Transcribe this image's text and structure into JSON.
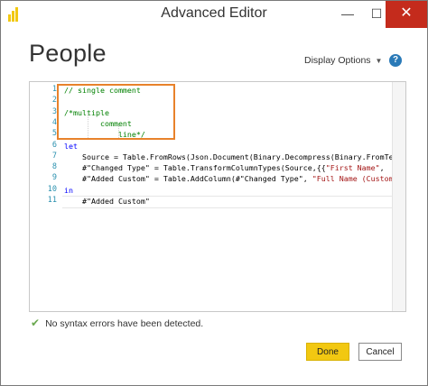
{
  "window": {
    "title": "Advanced Editor",
    "minimize_glyph": "—",
    "maximize_glyph": "☐",
    "close_glyph": "✕"
  },
  "header": {
    "page_title": "People",
    "display_options_label": "Display Options",
    "display_options_caret": "▼",
    "help_glyph": "?"
  },
  "editor": {
    "line_numbers": [
      "1",
      "2",
      "3",
      "4",
      "5",
      "6",
      "7",
      "8",
      "9",
      "10",
      "11"
    ],
    "lines": [
      [
        {
          "t": "// single comment",
          "c": "c-comment"
        }
      ],
      [],
      [
        {
          "t": "/*multiple",
          "c": "c-comment"
        }
      ],
      [
        {
          "t": "        comment",
          "c": "c-comment"
        }
      ],
      [
        {
          "t": "            line*/",
          "c": "c-comment"
        }
      ],
      [
        {
          "t": "let",
          "c": "c-kw"
        }
      ],
      [
        {
          "t": "    Source = Table.FromRows(Json.Document(Binary.Decompress(Binary.FromText(",
          "c": ""
        }
      ],
      [
        {
          "t": "    #\"Changed Type\" = Table.TransformColumnTypes(Source,{{",
          "c": ""
        },
        {
          "t": "\"First Name\"",
          "c": "c-str"
        },
        {
          "t": ",",
          "c": ""
        }
      ],
      [
        {
          "t": "    #\"Added Custom\" = Table.AddColumn(#\"Changed Type\", ",
          "c": ""
        },
        {
          "t": "\"Full Name (Custom)",
          "c": "c-str"
        }
      ],
      [
        {
          "t": "in",
          "c": "c-kw"
        }
      ],
      [
        {
          "t": "    #\"Added Custom\"",
          "c": ""
        }
      ]
    ]
  },
  "status": {
    "message": "No syntax errors have been detected.",
    "check_glyph": "✔"
  },
  "footer": {
    "done_label": "Done",
    "cancel_label": "Cancel"
  },
  "colors": {
    "accent_yellow": "#f2c811",
    "highlight_orange": "#e8822b",
    "close_red": "#c42b1c",
    "comment_green": "#008000",
    "keyword_blue": "#0000ff",
    "string_red": "#a31515"
  }
}
